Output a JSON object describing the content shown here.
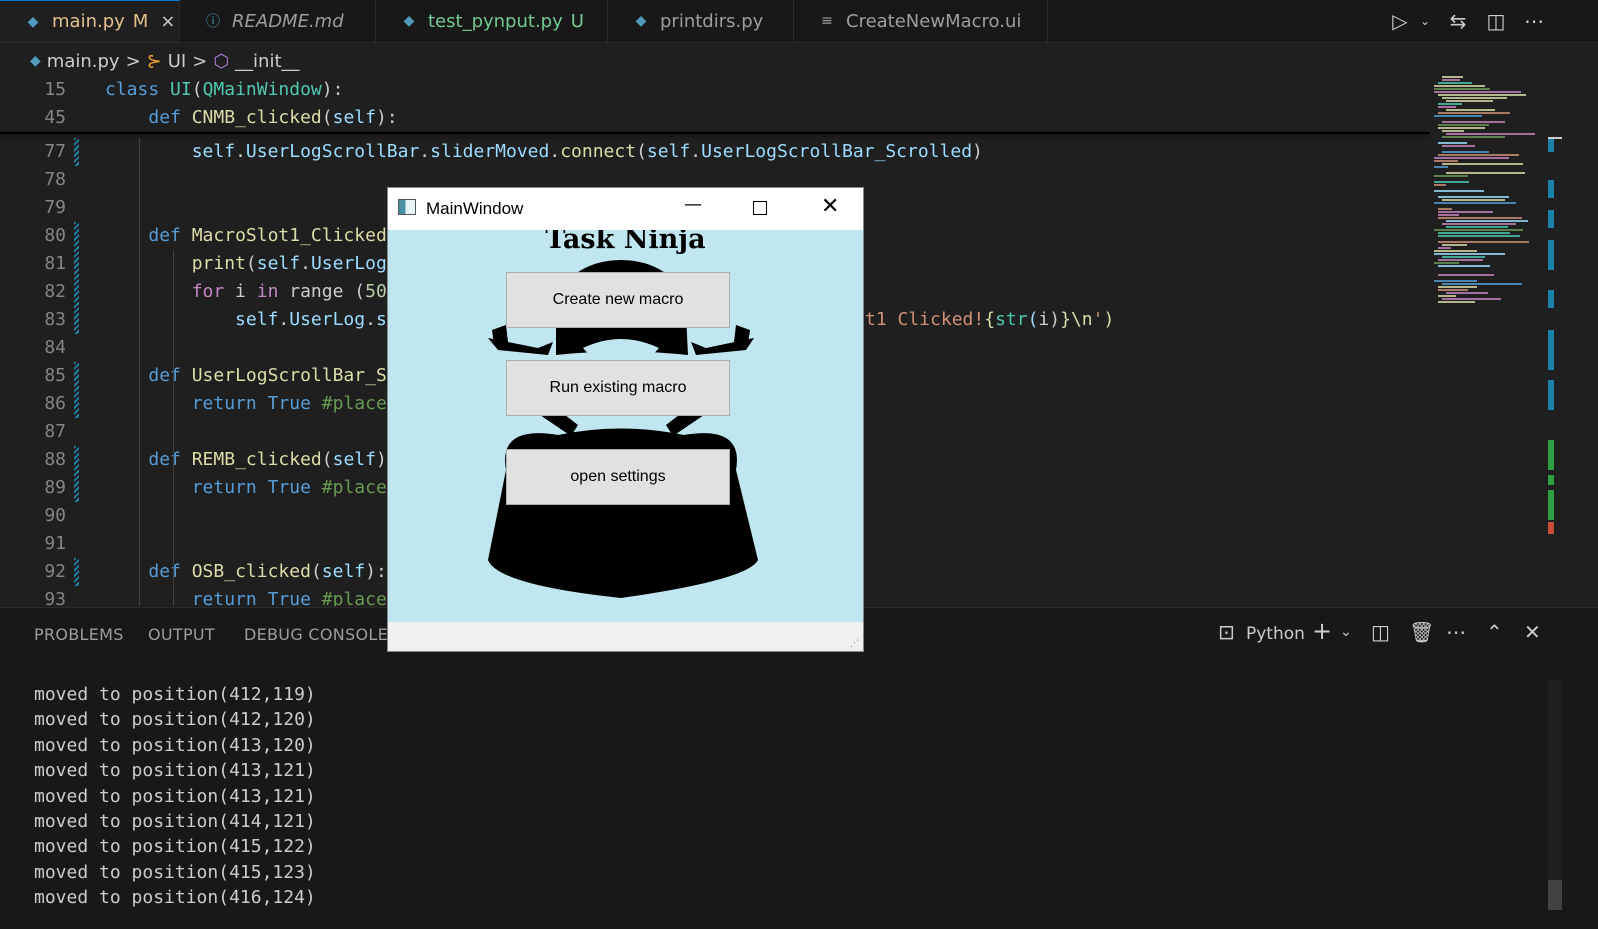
{
  "tabs": [
    {
      "label": "main.py",
      "badge": "M",
      "close": "×",
      "icon": "python-icon"
    },
    {
      "label": "README.md",
      "icon": "info-icon"
    },
    {
      "label": "test_pynput.py",
      "badge": "U",
      "icon": "python-icon"
    },
    {
      "label": "printdirs.py",
      "icon": "python-icon"
    },
    {
      "label": "CreateNewMacro.ui",
      "icon": "lines-icon"
    }
  ],
  "breadcrumb": {
    "file": "main.py",
    "sep1": ">",
    "cls": "UI",
    "sep2": ">",
    "method": "__init__"
  },
  "editor": {
    "lines": [
      {
        "n": "15",
        "t": "class UI(QMainWindow):"
      },
      {
        "n": "45",
        "t": "    def CNMB_clicked(self):"
      },
      {
        "n": "77",
        "t": "        self.UserLogScrollBar.sliderMoved.connect(self.UserLogScrollBar_Scrolled)"
      },
      {
        "n": "78",
        "t": ""
      },
      {
        "n": "79",
        "t": ""
      },
      {
        "n": "80",
        "t": "    def MacroSlot1_Clicked"
      },
      {
        "n": "81",
        "t": "        print(self.UserLog."
      },
      {
        "n": "82",
        "t": "        for i in range (50)"
      },
      {
        "n": "83",
        "t": "            self.UserLog.set",
        "tail": "t1 Clicked!{str(i)}\\n')"
      },
      {
        "n": "84",
        "t": ""
      },
      {
        "n": "85",
        "t": "    def UserLogScrollBar_S"
      },
      {
        "n": "86",
        "t": "        return True #placeh"
      },
      {
        "n": "87",
        "t": ""
      },
      {
        "n": "88",
        "t": "    def REMB_clicked(self)"
      },
      {
        "n": "89",
        "t": "        return True #placeh"
      },
      {
        "n": "90",
        "t": ""
      },
      {
        "n": "91",
        "t": ""
      },
      {
        "n": "92",
        "t": "    def OSB_clicked(self):"
      },
      {
        "n": "93",
        "t": "        return True #placeh"
      }
    ]
  },
  "panel": {
    "tabs": [
      "PROBLEMS",
      "OUTPUT",
      "DEBUG CONSOLE"
    ],
    "terminal_name": "Python",
    "output": [
      "moved to position(412,119)",
      "moved to position(412,120)",
      "moved to position(413,120)",
      "moved to position(413,121)",
      "moved to position(413,121)",
      "moved to position(414,121)",
      "moved to position(415,122)",
      "moved to position(415,123)",
      "moved to position(416,124)"
    ]
  },
  "qt_window": {
    "title": "MainWindow",
    "heading": "Task Ninja",
    "buttons": [
      "Create new macro",
      "Run existing macro",
      "open settings"
    ],
    "bg_color": "#c0e6f0"
  },
  "colors": {
    "accent": "#0078d4",
    "modified": "#e2c08d",
    "untracked": "#73c991"
  }
}
